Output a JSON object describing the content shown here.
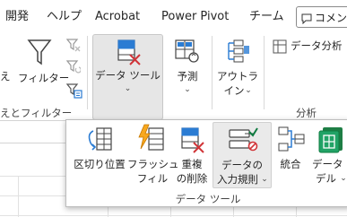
{
  "tabs": [
    "開発",
    "ヘルプ",
    "Acrobat",
    "Power Pivot",
    "チーム"
  ],
  "comment_button": "コメント",
  "ribbon": {
    "left_fragment": "え",
    "filter_label": "フィルター",
    "data_tool_label": "データ ツール",
    "forecast_label": "予測",
    "outline_label_1": "アウトラ",
    "outline_label_2": "イン",
    "data_analysis_label": "データ分析",
    "group_sort_filter": "えとフィルター",
    "group_analysis": "分析"
  },
  "popup": {
    "items": [
      {
        "label_1": "区切り位置",
        "label_2": ""
      },
      {
        "label_1": "フラッシュ",
        "label_2": "フィル"
      },
      {
        "label_1": "重複",
        "label_2": "の削除"
      },
      {
        "label_1": "データの",
        "label_2": "入力規則"
      },
      {
        "label_1": "統合",
        "label_2": ""
      },
      {
        "label_1": "データ モ",
        "label_2": "デル"
      }
    ],
    "group_label": "データ ツール"
  },
  "colors": {
    "accent_blue": "#2b7cd3",
    "accent_red": "#d13438",
    "accent_green": "#107c41",
    "selected_bg": "#e6e6e6"
  }
}
